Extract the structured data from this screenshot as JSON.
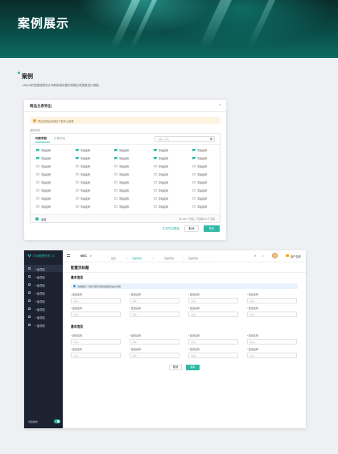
{
  "hero": {
    "title": "案例展示"
  },
  "section": {
    "title": "案例",
    "desc": "• Aliyun的宽度按照设计师和前端设置的表格区域宽度进行调整。"
  },
  "export_modal": {
    "title": "商品主表导出",
    "close": "×",
    "warning": "导出完成后请前往下载中心查看",
    "select_label": "选择字段",
    "tabs": [
      "列表字段",
      "扩展字段"
    ],
    "search_placeholder": "请输入字段",
    "fields": [
      {
        "label": "字段名称",
        "checked": true
      },
      {
        "label": "字段名称",
        "checked": true
      },
      {
        "label": "字段名称",
        "checked": true
      },
      {
        "label": "字段名称",
        "checked": true
      },
      {
        "label": "字段名称",
        "checked": true
      },
      {
        "label": "字段名称",
        "checked": true
      },
      {
        "label": "字段名称",
        "checked": true
      },
      {
        "label": "字段名称",
        "checked": true
      },
      {
        "label": "字段名称",
        "checked": true
      },
      {
        "label": "字段名称",
        "checked": true
      },
      {
        "label": "字段名称",
        "checked": false
      },
      {
        "label": "字段名称",
        "checked": false
      },
      {
        "label": "字段名称",
        "checked": false
      },
      {
        "label": "字段名称",
        "checked": false
      },
      {
        "label": "字段名称",
        "checked": false
      },
      {
        "label": "字段名称",
        "checked": false
      },
      {
        "label": "字段名称",
        "checked": false
      },
      {
        "label": "字段名称",
        "checked": false
      },
      {
        "label": "字段名称",
        "checked": false
      },
      {
        "label": "字段名称",
        "checked": false
      },
      {
        "label": "字段名称",
        "checked": false
      },
      {
        "label": "字段名称",
        "checked": false
      },
      {
        "label": "字段名称",
        "checked": false
      },
      {
        "label": "字段名称",
        "checked": false
      },
      {
        "label": "字段名称",
        "checked": false
      },
      {
        "label": "字段名称",
        "checked": false
      },
      {
        "label": "字段名称",
        "checked": false
      },
      {
        "label": "字段名称",
        "checked": false
      },
      {
        "label": "字段名称",
        "checked": false
      },
      {
        "label": "字段名称",
        "checked": false
      },
      {
        "label": "字段名称",
        "checked": false
      },
      {
        "label": "字段名称",
        "checked": false
      },
      {
        "label": "字段名称",
        "checked": false
      },
      {
        "label": "字段名称",
        "checked": false
      },
      {
        "label": "字段名称",
        "checked": false
      },
      {
        "label": "字段名称",
        "checked": false
      },
      {
        "label": "字段名称",
        "checked": false
      },
      {
        "label": "字段名称",
        "checked": false
      },
      {
        "label": "字段名称",
        "checked": false
      },
      {
        "label": "字段名称",
        "checked": false
      }
    ],
    "select_all": "全选",
    "count_text": "共 120 个字段，已选择 10 个字段",
    "generate_link": "生成导出模板",
    "cancel": "取消",
    "export": "导出"
  },
  "admin": {
    "brand": "中台管理系统 2.0",
    "menu": [
      "一级导航",
      "一级导航",
      "一级导航",
      "一级导航",
      "一级导航",
      "一级导航",
      "一级导航",
      "一级导航"
    ],
    "toggle_label": "切换模式",
    "org": "MDC",
    "org_chevron": "▾",
    "crumbs": [
      "首页",
      "包裹导航",
      "包裹导航",
      "包裹导航",
      "包裹导航"
    ],
    "user_name": "用户名称",
    "page_title": "配置页标题",
    "basic_info": "基本信息",
    "info_text": "请根据以下提示填写完整的配置信息内容",
    "fields_label": "* 配置名称",
    "placeholder": "请输入",
    "group2": "基本信息",
    "cancel": "取消",
    "save": "保存",
    "accent": "#2fb8a5"
  }
}
